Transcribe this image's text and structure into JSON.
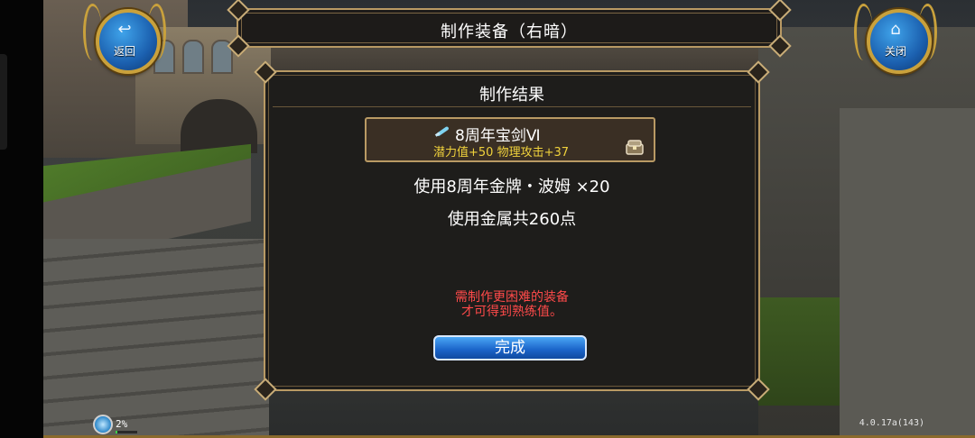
{
  "window": {
    "title": "制作装备（右暗）"
  },
  "buttons": {
    "back_label": "返回",
    "close_label": "关闭"
  },
  "dialog": {
    "header": "制作结果",
    "item": {
      "name": "8周年宝剑Ⅵ",
      "stats": "潜力值+50  物理攻击+37",
      "icon": "sword-icon",
      "badge_icon": "chest-icon"
    },
    "cost_line_1": "使用8周年金牌・波姆 ×20",
    "cost_line_2": "使用金属共260点",
    "warning_line_1": "需制作更困难的装备",
    "warning_line_2": "才可得到熟练值。",
    "done_label": "完成"
  },
  "hud": {
    "progress_text": "2%",
    "progress_value": 0.02,
    "version": "4.0.17a(143)"
  },
  "colors": {
    "frame_gold": "#b99a64",
    "stat_yellow": "#f0d23c",
    "warning_red": "#ff4a4a",
    "button_blue": "#1a63c8"
  }
}
